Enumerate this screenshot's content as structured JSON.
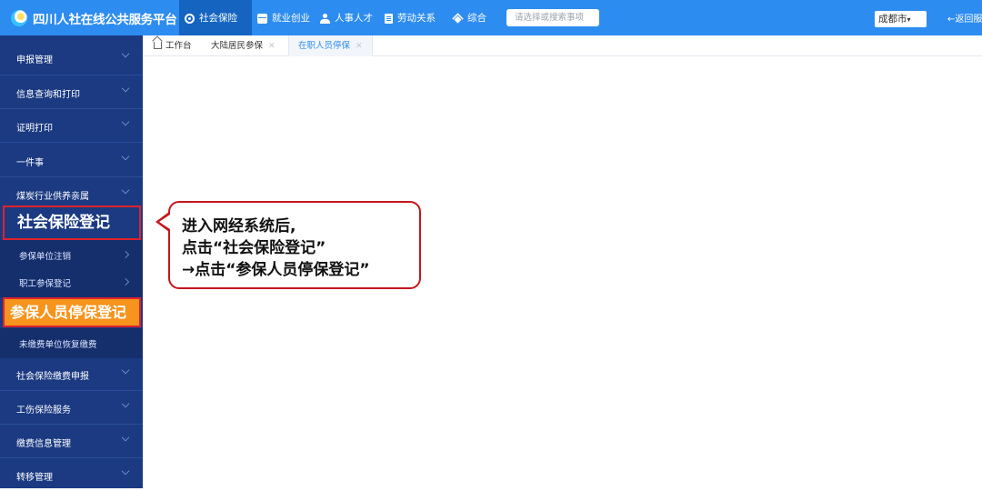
{
  "header": {
    "title": "四川人社在线公共服务平台",
    "nav": [
      {
        "label": "社会保险",
        "icon": "hand-icon"
      },
      {
        "label": "就业创业",
        "icon": "briefcase-icon"
      },
      {
        "label": "人事人才",
        "icon": "people-icon"
      },
      {
        "label": "劳动关系",
        "icon": "document-icon"
      },
      {
        "label": "综合",
        "icon": "layers-icon"
      }
    ],
    "search_placeholder": "请选择或搜索事项",
    "city": "成都市",
    "back_label": "←返回服"
  },
  "sidebar": {
    "items": [
      {
        "label": "申报管理"
      },
      {
        "label": "信息查询和打印"
      },
      {
        "label": "证明打印"
      },
      {
        "label": "一件事"
      },
      {
        "label": "煤炭行业供养亲属"
      },
      {
        "label": "社会保险登记"
      },
      {
        "label": "参保单位注销"
      },
      {
        "label": "职工参保登记"
      },
      {
        "label": "参保人员停保登记"
      },
      {
        "label": "未缴费单位恢复缴费"
      },
      {
        "label": "社会保险缴费申报"
      },
      {
        "label": "工伤保险服务"
      },
      {
        "label": "缴费信息管理"
      },
      {
        "label": "转移管理"
      }
    ]
  },
  "tabs": [
    {
      "label": "工作台"
    },
    {
      "label": "大陆居民参保"
    },
    {
      "label": "在职人员停保"
    }
  ],
  "callout": {
    "lines": [
      "进入网经系统后,",
      "点击“社会保险登记”",
      "→点击“参保人员停保登记”"
    ]
  },
  "colors": {
    "topbar": "#2d8cf0",
    "sidebar": "#1b3a82",
    "highlight_red": "#e0222a",
    "highlight_orange": "#f7941d"
  }
}
